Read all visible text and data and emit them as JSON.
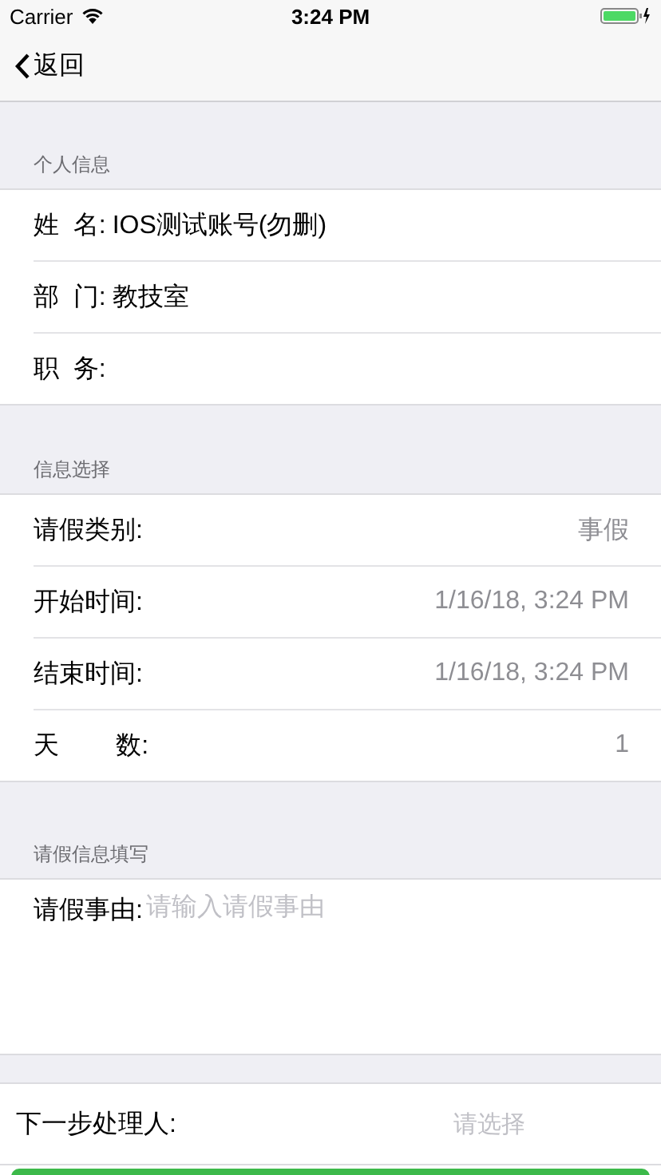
{
  "status_bar": {
    "carrier": "Carrier",
    "time": "3:24 PM"
  },
  "nav_bar": {
    "back": "返回"
  },
  "sections": [
    {
      "header": "个人信息",
      "rows": [
        {
          "kind": "inline",
          "label": "姓  名:",
          "value": "IOS测试账号(勿删)"
        },
        {
          "kind": "inline",
          "label": "部  门:",
          "value": "教技室"
        },
        {
          "kind": "inline",
          "label": "职  务:"
        }
      ]
    },
    {
      "header": "信息选择",
      "rows": [
        {
          "kind": "detail",
          "label": "请假类别:",
          "value": "事假"
        },
        {
          "kind": "detail",
          "label": "开始时间:",
          "value": "1/16/18, 3:24 PM"
        },
        {
          "kind": "detail",
          "label": "结束时间:",
          "value": "1/16/18, 3:24 PM"
        },
        {
          "kind": "detail",
          "label": "天        数:",
          "value": "1"
        }
      ]
    },
    {
      "header": "请假信息填写",
      "rows": [
        {
          "kind": "textarea",
          "label": "请假事由:",
          "placeholder": "请输入请假事由"
        }
      ]
    },
    {
      "rows": [
        {
          "kind": "picker",
          "label": "下一步处理人:",
          "placeholder": "请选择"
        }
      ]
    }
  ]
}
